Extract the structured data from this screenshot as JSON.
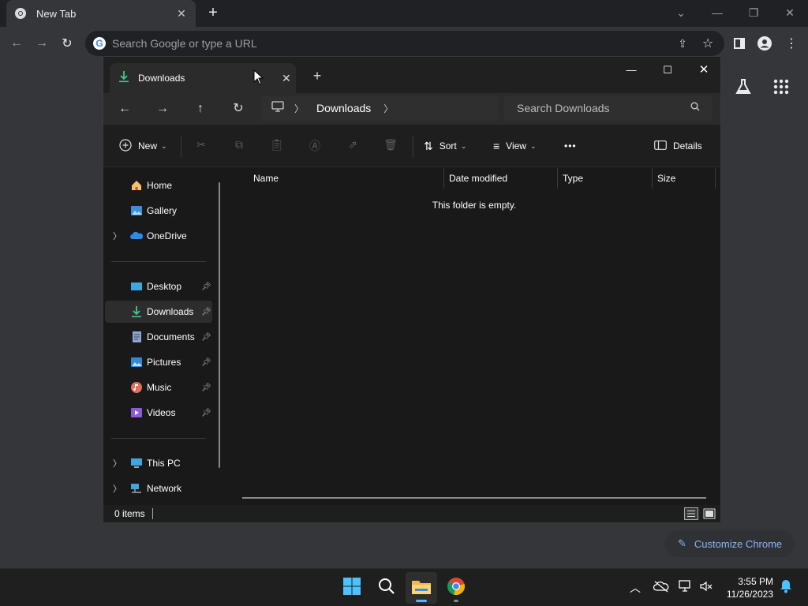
{
  "chrome": {
    "tab_title": "New Tab",
    "tab_close": "✕",
    "new_tab": "+",
    "omnibox_placeholder": "Search Google or type a URL",
    "customize_label": "Customize Chrome"
  },
  "explorer": {
    "tab_title": "Downloads",
    "tab_close": "✕",
    "new_tab": "+",
    "breadcrumb": [
      "Downloads"
    ],
    "search_placeholder": "Search Downloads",
    "commands": {
      "new": "New",
      "sort": "Sort",
      "view": "View",
      "more": "•••",
      "details": "Details"
    },
    "sidebar": {
      "items": [
        {
          "label": "Home",
          "icon": "home-icon"
        },
        {
          "label": "Gallery",
          "icon": "gallery-icon"
        },
        {
          "label": "OneDrive",
          "icon": "onedrive-icon"
        },
        {
          "label": "Desktop",
          "icon": "desktop-icon"
        },
        {
          "label": "Downloads",
          "icon": "downloads-icon"
        },
        {
          "label": "Documents",
          "icon": "documents-icon"
        },
        {
          "label": "Pictures",
          "icon": "pictures-icon"
        },
        {
          "label": "Music",
          "icon": "music-icon"
        },
        {
          "label": "Videos",
          "icon": "videos-icon"
        },
        {
          "label": "This PC",
          "icon": "this-pc-icon"
        },
        {
          "label": "Network",
          "icon": "network-icon"
        }
      ],
      "selected": "Downloads"
    },
    "columns": [
      "Name",
      "Date modified",
      "Type",
      "Size"
    ],
    "empty_message": "This folder is empty.",
    "status_count": "0 items"
  },
  "taskbar": {
    "time": "3:55 PM",
    "date": "11/26/2023"
  },
  "colors": {
    "accent": "#5fb2f2",
    "chrome_link": "#8ab4f8"
  }
}
